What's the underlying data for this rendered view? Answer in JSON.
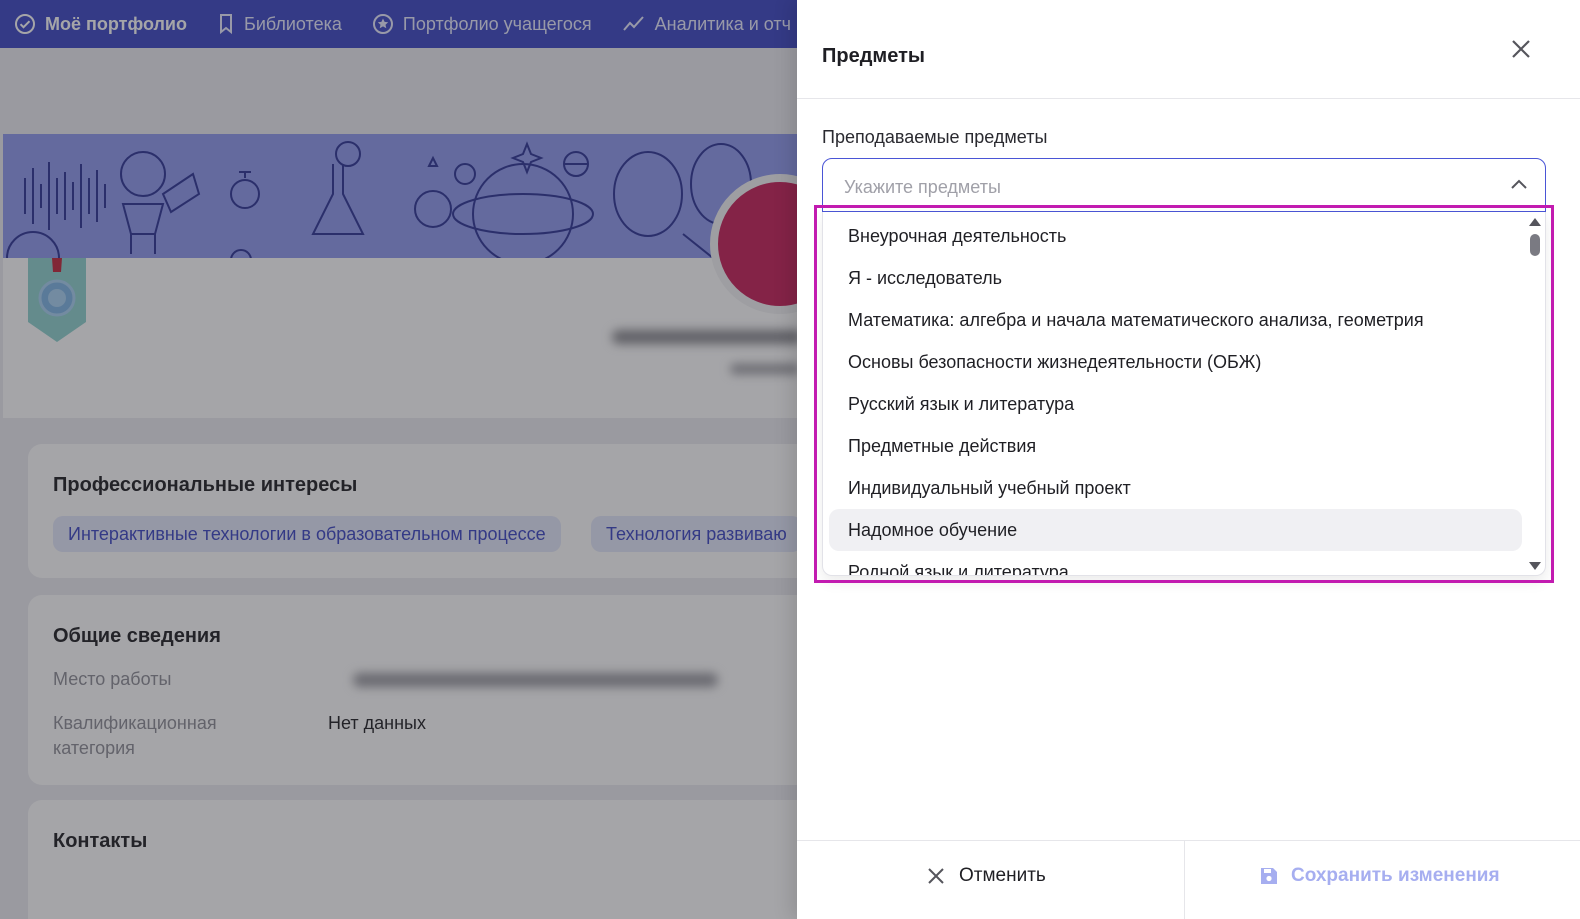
{
  "nav": {
    "items": [
      {
        "label": "Моё портфолио",
        "icon": "check-circle-icon",
        "active": true
      },
      {
        "label": "Библиотека",
        "icon": "bookmark-icon",
        "active": false
      },
      {
        "label": "Портфолио учащегося",
        "icon": "star-circle-icon",
        "active": false
      },
      {
        "label": "Аналитика и отч",
        "icon": "trend-icon",
        "active": false
      }
    ]
  },
  "profile": {
    "interests": {
      "title": "Профессиональные интересы",
      "chips": [
        "Интерактивные технологии в образовательном процессе",
        "Технология развиваю"
      ]
    },
    "general": {
      "title": "Общие сведения",
      "work_label": "Место работы",
      "category_label_line1": "Квалификационная",
      "category_label_line2": "категория",
      "category_value": "Нет данных"
    },
    "contacts": {
      "title": "Контакты"
    }
  },
  "drawer": {
    "title": "Предметы",
    "field_label": "Преподаваемые предметы",
    "placeholder": "Укажите предметы",
    "options": [
      "Внеурочная деятельность",
      "Я - исследователь",
      "Математика: алгебра и начала математического анализа, геометрия",
      "Основы безопасности жизнедеятельности (ОБЖ)",
      "Русский язык и литература",
      "Предметные действия",
      "Индивидуальный учебный проект",
      "Надомное обучение",
      "Родной язык и литература"
    ],
    "hovered_option": "Надомное обучение",
    "cancel_label": "Отменить",
    "save_label": "Сохранить изменения"
  },
  "colors": {
    "brand": "#3d47c4",
    "highlight": "#c21bb0",
    "save_disabled": "#a6aef0"
  }
}
